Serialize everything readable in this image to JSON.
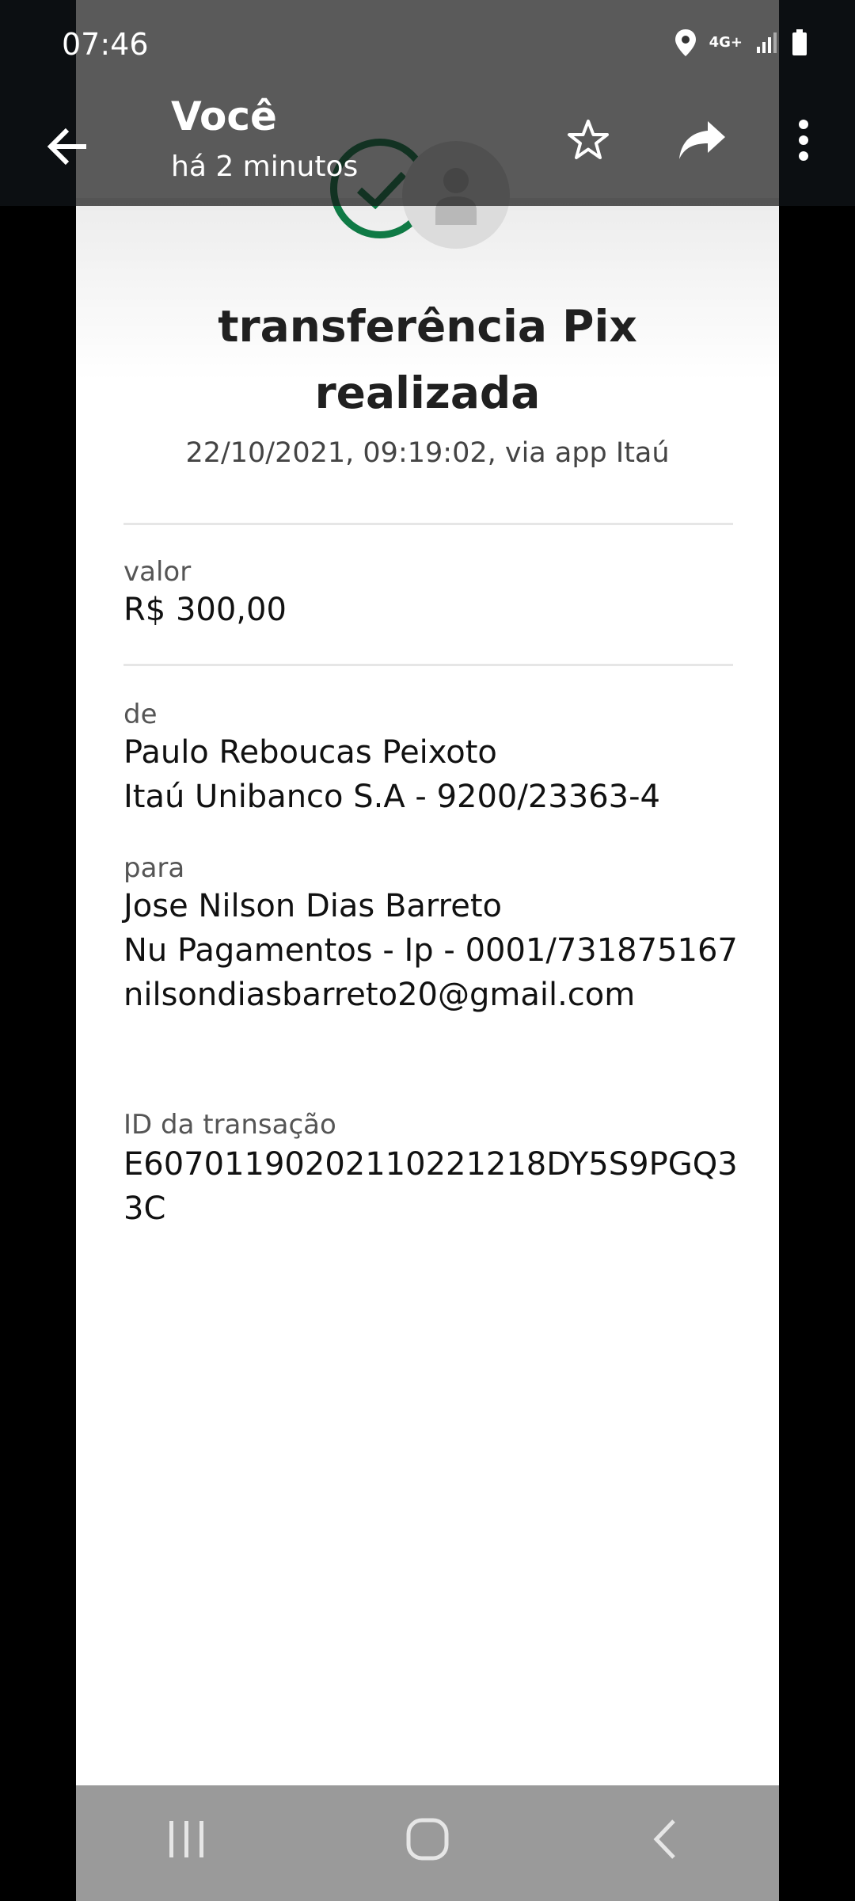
{
  "status_bar": {
    "time": "07:46",
    "network": "4G+"
  },
  "app_bar": {
    "title": "Você",
    "subtitle": "há 2 minutos"
  },
  "receipt": {
    "title_line1": "transferência Pix",
    "title_line2": "realizada",
    "datetime": "22/10/2021,  09:19:02, via app Itaú",
    "amount_label": "valor",
    "amount": "R$ 300,00",
    "from_label": "de",
    "from_name": "Paulo Reboucas Peixoto",
    "from_account": "Itaú Unibanco S.A - 9200/23363-4",
    "to_label": "para",
    "to_name": "Jose Nilson Dias Barreto",
    "to_account": "Nu Pagamentos - Ip - 0001/731875167",
    "to_email": "nilsondiasbarreto20@gmail.com",
    "txid_label": "ID da transação",
    "txid_line1": "E60701190202110221218DY5S9PGQ3",
    "txid_line2": "3C"
  },
  "colors": {
    "accent_green": "#0f7a45",
    "overlay": "#141414",
    "nav_bar": "#9a9a9a"
  },
  "icons": [
    "back-arrow-icon",
    "star-icon",
    "share-icon",
    "more-vert-icon",
    "location-icon",
    "signal-icon",
    "battery-icon",
    "check-icon",
    "person-icon",
    "recents-icon",
    "home-icon",
    "nav-back-icon"
  ]
}
